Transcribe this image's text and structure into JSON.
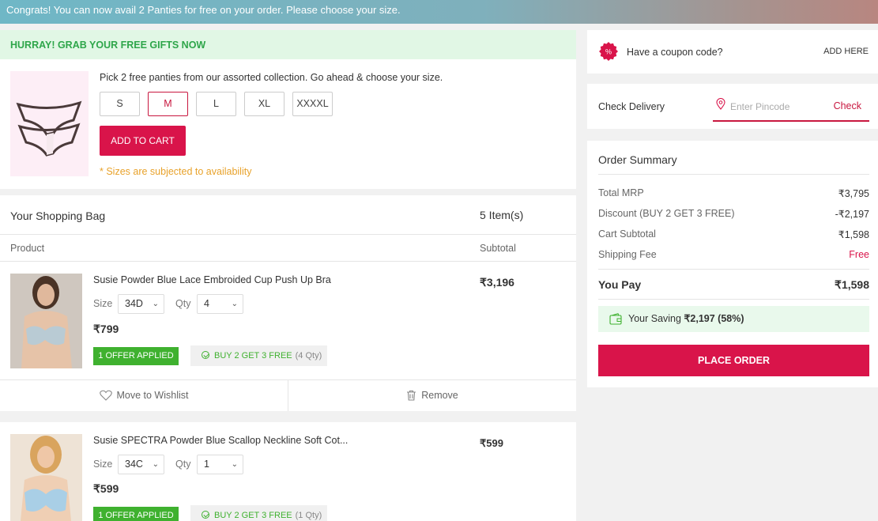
{
  "banner": {
    "text": "Congrats! You can now avail 2 Panties for free on your order. Please choose your size."
  },
  "gifts": {
    "heading": "HURRAY! GRAB YOUR FREE GIFTS NOW",
    "instruction": "Pick 2 free panties from our assorted collection. Go ahead & choose your size.",
    "sizes": [
      "S",
      "M",
      "L",
      "XL",
      "XXXXL"
    ],
    "selected_size": "M",
    "add_to_cart_label": "ADD TO CART",
    "availability_note": "* Sizes are subjected to availability"
  },
  "bag": {
    "title": "Your Shopping Bag",
    "count": "5 Item(s)",
    "col_product": "Product",
    "col_subtotal": "Subtotal",
    "wishlist_label": "Move to Wishlist",
    "remove_label": "Remove",
    "items": [
      {
        "name": "Susie Powder Blue Lace Embroided Cup Push Up Bra",
        "size_label": "Size",
        "size": "34D",
        "qty_label": "Qty",
        "qty": "4",
        "price": "₹799",
        "subtotal": "₹3,196",
        "offer_badge": "1 OFFER APPLIED",
        "offer_name": "BUY 2 GET 3 FREE",
        "offer_qty": "(4 Qty)"
      },
      {
        "name": "Susie SPECTRA Powder Blue Scallop Neckline Soft Cot...",
        "size_label": "Size",
        "size": "34C",
        "qty_label": "Qty",
        "qty": "1",
        "price": "₹599",
        "subtotal": "₹599",
        "offer_badge": "1 OFFER APPLIED",
        "offer_name": "BUY 2 GET 3 FREE",
        "offer_qty": "(1 Qty)"
      }
    ]
  },
  "coupon": {
    "text": "Have a coupon code?",
    "link": "ADD HERE"
  },
  "delivery": {
    "label": "Check Delivery",
    "placeholder": "Enter Pincode",
    "check_label": "Check"
  },
  "summary": {
    "title": "Order Summary",
    "rows": [
      {
        "label": "Total MRP",
        "value": "₹3,795"
      },
      {
        "label": "Discount (BUY 2 GET 3 FREE)",
        "value": "-₹2,197"
      },
      {
        "label": "Cart Subtotal",
        "value": "₹1,598"
      },
      {
        "label": "Shipping Fee",
        "value": "Free"
      }
    ],
    "pay_label": "You Pay",
    "pay_value": "₹1,598",
    "saving_prefix": "Your Saving ",
    "saving_amount": "₹2,197",
    "saving_pct": "(58%)",
    "place_order_label": "PLACE ORDER"
  },
  "colors": {
    "brand": "#d9144a",
    "offer_green": "#3fb12f",
    "gift_header_bg": "#e1f7e5",
    "note_orange": "#e8a22b"
  }
}
